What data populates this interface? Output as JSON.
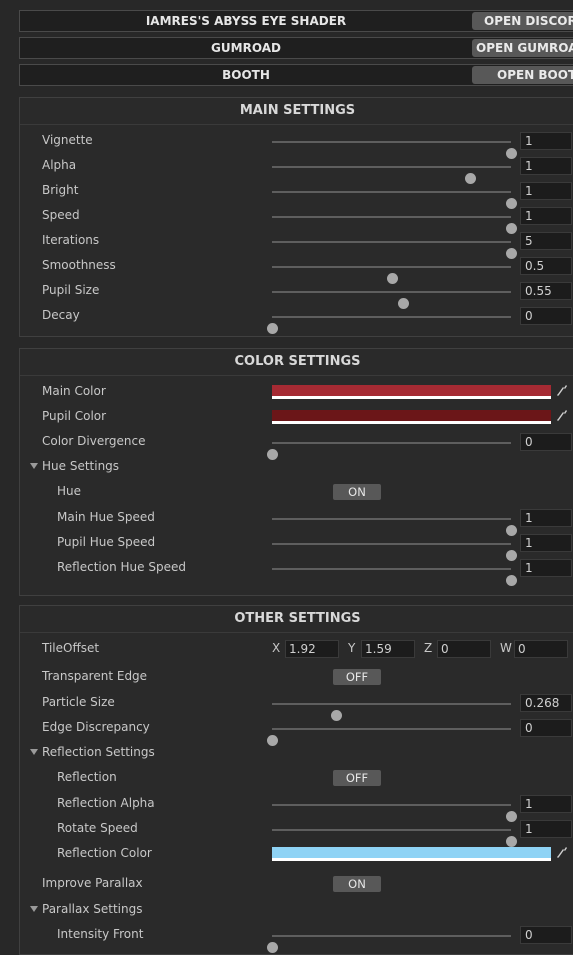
{
  "header": {
    "title": {
      "label": "IAMRES'S ABYSS EYE SHADER",
      "button": "OPEN DISCORD"
    },
    "gumroad": {
      "label": "GUMROAD",
      "button": "OPEN GUMROAD"
    },
    "booth": {
      "label": "BOOTH",
      "button": "OPEN BOOTH"
    }
  },
  "main_settings": {
    "title": "MAIN SETTINGS",
    "rows": [
      {
        "label": "Vignette",
        "value": "1",
        "fraction": 1.0
      },
      {
        "label": "Alpha",
        "value": "1",
        "fraction": 0.83
      },
      {
        "label": "Bright",
        "value": "1",
        "fraction": 1.0
      },
      {
        "label": "Speed",
        "value": "1",
        "fraction": 1.0
      },
      {
        "label": "Iterations",
        "value": "5",
        "fraction": 1.0
      },
      {
        "label": "Smoothness",
        "value": "0.5",
        "fraction": 0.5
      },
      {
        "label": "Pupil Size",
        "value": "0.55",
        "fraction": 0.55
      },
      {
        "label": "Decay",
        "value": "0",
        "fraction": 0.0
      }
    ]
  },
  "color_settings": {
    "title": "COLOR SETTINGS",
    "main_color": {
      "label": "Main Color",
      "color": "#a52a33"
    },
    "pupil_color": {
      "label": "Pupil Color",
      "color": "#6b1618"
    },
    "divergence": {
      "label": "Color Divergence",
      "value": "0",
      "fraction": 0.0
    },
    "hue_settings": {
      "label": "Hue Settings",
      "hue": {
        "label": "Hue",
        "state": "ON"
      },
      "main_hue_speed": {
        "label": "Main Hue Speed",
        "value": "1",
        "fraction": 1.0
      },
      "pupil_hue_speed": {
        "label": "Pupil Hue Speed",
        "value": "1",
        "fraction": 1.0
      },
      "reflection_hue_speed": {
        "label": "Reflection Hue Speed",
        "value": "1",
        "fraction": 1.0
      }
    }
  },
  "other_settings": {
    "title": "OTHER SETTINGS",
    "tile_offset": {
      "label": "TileOffset",
      "x": "1.92",
      "y": "1.59",
      "z": "0",
      "w": "0",
      "x_label": "X",
      "y_label": "Y",
      "z_label": "Z",
      "w_label": "W"
    },
    "transparent_edge": {
      "label": "Transparent Edge",
      "state": "OFF"
    },
    "particle_size": {
      "label": "Particle Size",
      "value": "0.268",
      "fraction": 0.268
    },
    "edge_discrepancy": {
      "label": "Edge Discrepancy",
      "value": "0",
      "fraction": 0.0
    },
    "reflection_settings": {
      "label": "Reflection Settings",
      "reflection": {
        "label": "Reflection",
        "state": "OFF"
      },
      "reflection_alpha": {
        "label": "Reflection Alpha",
        "value": "1",
        "fraction": 1.0
      },
      "rotate_speed": {
        "label": "Rotate Speed",
        "value": "1",
        "fraction": 1.0
      },
      "reflection_color": {
        "label": "Reflection Color",
        "color": "#8fd3f5"
      }
    },
    "improve_parallax": {
      "label": "Improve Parallax",
      "state": "ON"
    },
    "parallax_settings": {
      "label": "Parallax Settings",
      "intensity_front": {
        "label": "Intensity Front",
        "value": "0",
        "fraction": 0.0
      }
    }
  }
}
